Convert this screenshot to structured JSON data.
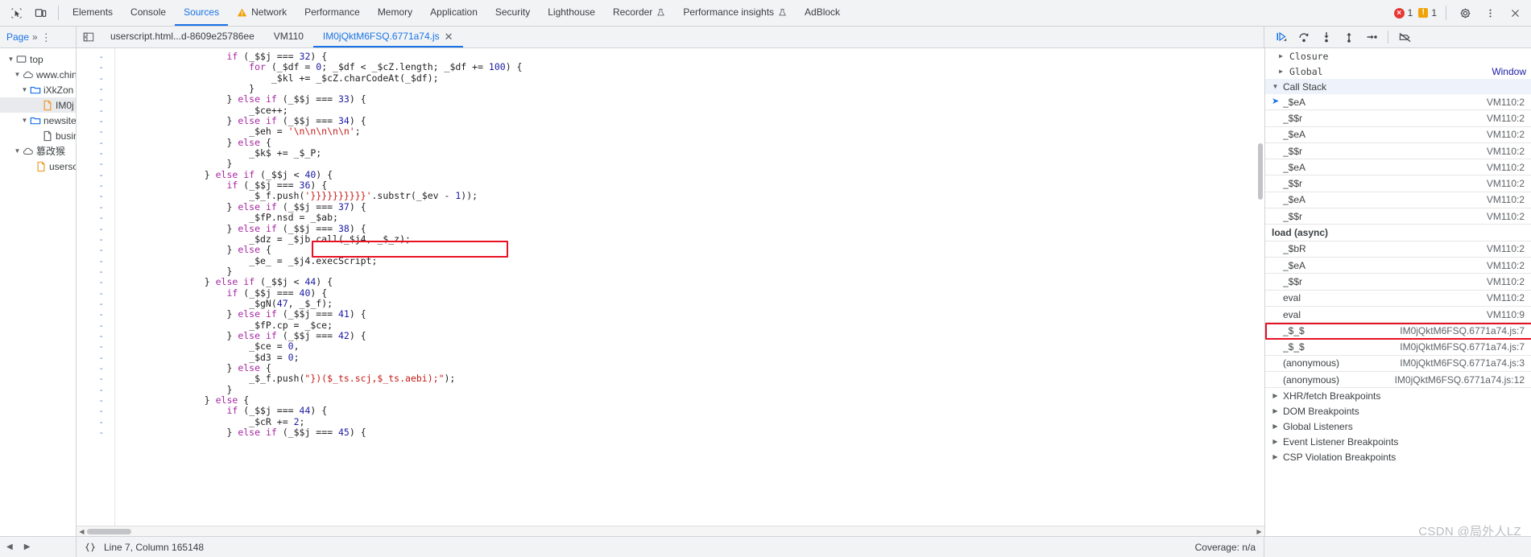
{
  "window": {
    "title": "Chrome DevTools - Sources"
  },
  "topbar": {
    "inspect_icon": "inspect-element-icon",
    "device_icon": "device-toolbar-icon",
    "tabs": [
      {
        "label": "Elements",
        "active": false,
        "warn": false
      },
      {
        "label": "Console",
        "active": false,
        "warn": false
      },
      {
        "label": "Sources",
        "active": true,
        "warn": false
      },
      {
        "label": "Network",
        "active": false,
        "warn": true
      },
      {
        "label": "Performance",
        "active": false,
        "warn": false
      },
      {
        "label": "Memory",
        "active": false,
        "warn": false
      },
      {
        "label": "Application",
        "active": false,
        "warn": false
      },
      {
        "label": "Security",
        "active": false,
        "warn": false
      },
      {
        "label": "Lighthouse",
        "active": false,
        "warn": false
      },
      {
        "label": "Recorder",
        "active": false,
        "warn": false,
        "badge": "experiment"
      },
      {
        "label": "Performance insights",
        "active": false,
        "warn": false,
        "badge": "experiment"
      },
      {
        "label": "AdBlock",
        "active": false,
        "warn": false
      }
    ],
    "error_count": "1",
    "warning_count": "1",
    "settings_icon": "gear-icon",
    "more_icon": "more-vertical-icon",
    "close_icon": "close-icon"
  },
  "sourcesbar": {
    "nav_tab": "Page",
    "more_tabs_icon": "chevrons-right-icon",
    "more_options_icon": "more-vertical-icon",
    "panel_toggle_icon": "show-navigator-icon",
    "file_tabs": [
      {
        "label": "userscript.html...d-8609e25786ee",
        "active": false,
        "closable": false
      },
      {
        "label": "VM110",
        "active": false,
        "closable": false
      },
      {
        "label": "IM0jQktM6FSQ.6771a74.js",
        "active": true,
        "closable": true
      }
    ],
    "debug_buttons": [
      {
        "name": "resume-script-execution",
        "icon": "play-pause-icon"
      },
      {
        "name": "step-over-next-function-call",
        "icon": "step-over-icon"
      },
      {
        "name": "step-into-next-function-call",
        "icon": "step-into-icon"
      },
      {
        "name": "step-out-of-current-function",
        "icon": "step-out-icon"
      },
      {
        "name": "step",
        "icon": "step-icon"
      },
      {
        "name": "deactivate-breakpoints",
        "icon": "deactivate-breakpoints-icon"
      }
    ]
  },
  "navigator": {
    "items": [
      {
        "label": "top",
        "depth": 0,
        "icon": "frame-icon",
        "expanded": true,
        "selected": false
      },
      {
        "label": "www.chin",
        "depth": 1,
        "icon": "cloud-icon",
        "expanded": true,
        "selected": false
      },
      {
        "label": "iXkZon",
        "depth": 2,
        "icon": "folder-icon",
        "expanded": true,
        "selected": false
      },
      {
        "label": "IM0j",
        "depth": 3,
        "icon": "js-file-icon",
        "expanded": null,
        "selected": true
      },
      {
        "label": "newsite",
        "depth": 2,
        "icon": "folder-icon",
        "expanded": true,
        "selected": false
      },
      {
        "label": "busin",
        "depth": 3,
        "icon": "file-icon",
        "expanded": null,
        "selected": false
      },
      {
        "label": "篡改猴",
        "depth": 1,
        "icon": "cloud-icon",
        "expanded": true,
        "selected": false
      },
      {
        "label": "userscr",
        "depth": 2,
        "icon": "js-file-icon",
        "expanded": null,
        "selected": false
      }
    ]
  },
  "editor": {
    "lines": [
      "                    if (_$$j === 32) {",
      "                        for (_$df = 0; _$df < _$cZ.length; _$df += 100) {",
      "                            _$kl += _$cZ.charCodeAt(_$df);",
      "                        }",
      "                    } else if (_$$j === 33) {",
      "                        _$ce++;",
      "                    } else if (_$$j === 34) {",
      "                        _$eh = '\\n\\n\\n\\n\\n';",
      "                    } else {",
      "                        _$k$ += _$_P;",
      "                    }",
      "                } else if (_$$j < 40) {",
      "                    if (_$$j === 36) {",
      "                        _$_f.push('}}}}}}}}}}'.substr(_$ev - 1));",
      "                    } else if (_$$j === 37) {",
      "                        _$fP.nsd = _$ab;",
      "                    } else if (_$$j === 38) {",
      "                        _$dz = _$jb.call(_$j4, _$_z);",
      "                    } else {",
      "                        _$e_ = _$j4.execScript;",
      "                    }",
      "                } else if (_$$j < 44) {",
      "                    if (_$$j === 40) {",
      "                        _$gN(47, _$_f);",
      "                    } else if (_$$j === 41) {",
      "                        _$fP.cp = _$ce;",
      "                    } else if (_$$j === 42) {",
      "                        _$ce = 0,",
      "                        _$d3 = 0;",
      "                    } else {",
      "                        _$_f.push(\"})($_ts.scj,$_ts.aebi);\");",
      "                    }",
      "                } else {",
      "                    if (_$$j === 44) {",
      "                        _$cR += 2;",
      "                    } else if (_$$j === 45) {"
    ],
    "gutter_marker": "-",
    "highlight_line_index": 17
  },
  "debugger": {
    "scopes": [
      {
        "label": "Closure",
        "expanded": false,
        "value": ""
      },
      {
        "label": "Global",
        "expanded": false,
        "value": "Window"
      }
    ],
    "callstack_header": "Call Stack",
    "callstack": [
      {
        "name": "_$eA",
        "location": "VM110:2",
        "current": true,
        "async": false,
        "highlight": false
      },
      {
        "name": "_$$r",
        "location": "VM110:2",
        "current": false,
        "async": false,
        "highlight": false
      },
      {
        "name": "_$eA",
        "location": "VM110:2",
        "current": false,
        "async": false,
        "highlight": false
      },
      {
        "name": "_$$r",
        "location": "VM110:2",
        "current": false,
        "async": false,
        "highlight": false
      },
      {
        "name": "_$eA",
        "location": "VM110:2",
        "current": false,
        "async": false,
        "highlight": false
      },
      {
        "name": "_$$r",
        "location": "VM110:2",
        "current": false,
        "async": false,
        "highlight": false
      },
      {
        "name": "_$eA",
        "location": "VM110:2",
        "current": false,
        "async": false,
        "highlight": false
      },
      {
        "name": "_$$r",
        "location": "VM110:2",
        "current": false,
        "async": false,
        "highlight": false
      },
      {
        "name": "load (async)",
        "location": "",
        "current": false,
        "async": true,
        "highlight": false
      },
      {
        "name": "_$bR",
        "location": "VM110:2",
        "current": false,
        "async": false,
        "highlight": false
      },
      {
        "name": "_$eA",
        "location": "VM110:2",
        "current": false,
        "async": false,
        "highlight": false
      },
      {
        "name": "_$$r",
        "location": "VM110:2",
        "current": false,
        "async": false,
        "highlight": false
      },
      {
        "name": "eval",
        "location": "VM110:2",
        "current": false,
        "async": false,
        "highlight": false
      },
      {
        "name": "eval",
        "location": "VM110:9",
        "current": false,
        "async": false,
        "highlight": false
      },
      {
        "name": "_$_$",
        "location": "IM0jQktM6FSQ.6771a74.js:7",
        "current": false,
        "async": false,
        "highlight": true
      },
      {
        "name": "_$_$",
        "location": "IM0jQktM6FSQ.6771a74.js:7",
        "current": false,
        "async": false,
        "highlight": false
      },
      {
        "name": "(anonymous)",
        "location": "IM0jQktM6FSQ.6771a74.js:3",
        "current": false,
        "async": false,
        "highlight": false
      },
      {
        "name": "(anonymous)",
        "location": "IM0jQktM6FSQ.6771a74.js:12",
        "current": false,
        "async": false,
        "highlight": false
      }
    ],
    "breakpoint_sections": [
      "XHR/fetch Breakpoints",
      "DOM Breakpoints",
      "Global Listeners",
      "Event Listener Breakpoints",
      "CSP Violation Breakpoints"
    ]
  },
  "statusbar": {
    "format_icon": "format-braces-icon",
    "cursor_position": "Line 7, Column 165148",
    "coverage": "Coverage: n/a",
    "back_icon": "chevron-left-icon",
    "forward_icon": "chevron-right-icon"
  },
  "watermark": "CSDN @局外人LZ",
  "colors": {
    "accent": "#1a73e8",
    "highlight_border": "#e81123",
    "toolbar_bg": "#f1f3f4",
    "error": "#e53935",
    "warning": "#f0a30a"
  }
}
